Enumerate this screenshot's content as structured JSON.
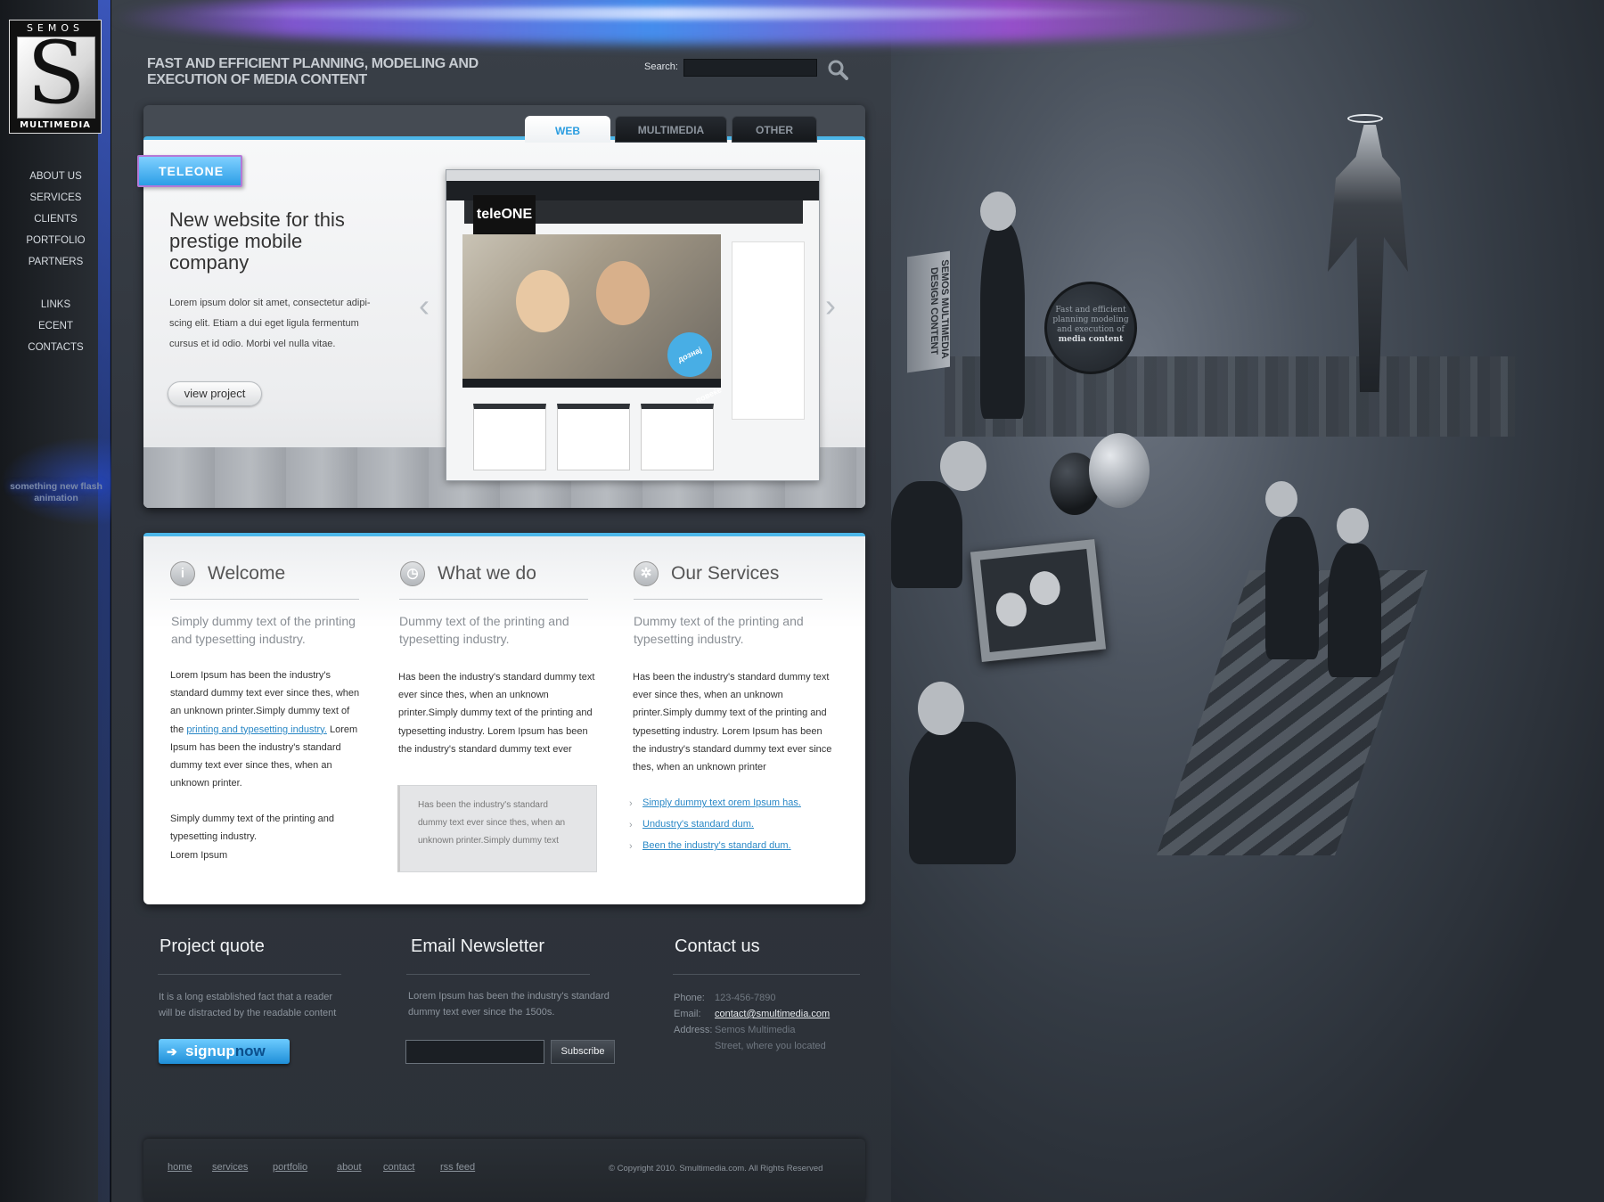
{
  "brand": {
    "logo_top": "SEMOS",
    "logo_bottom": "MULTIMEDIA",
    "logo_letter": "S",
    "tagline": "FAST AND EFFICIENT PLANNING, MODELING AND EXECUTION OF MEDIA CONTENT"
  },
  "sidebar": {
    "main_nav": [
      "ABOUT US",
      "SERVICES",
      "CLIENTS",
      "PORTFOLIO",
      "PARTNERS"
    ],
    "sub_nav": [
      "LINKS",
      "ECENT",
      "CONTACTS"
    ],
    "flash_note": "something new flash animation"
  },
  "search": {
    "label": "Search:",
    "value": "",
    "icon": "search-icon"
  },
  "slider": {
    "tabs": [
      {
        "label": "WEB",
        "active": true
      },
      {
        "label": "MULTIMEDIA",
        "active": false
      },
      {
        "label": "OTHER",
        "active": false
      }
    ],
    "badge": "TELEONE",
    "title": "New website for this prestige mobile company",
    "text": "Lorem ipsum dolor sit amet, consectetur adipi-scing elit. Etiam a dui eget ligula fermentum cursus et id odio. Morbi vel nulla vitae.",
    "button": "view project",
    "mock_logo": "teleONE",
    "mock_sticker": "дознај повеќе"
  },
  "columns": [
    {
      "icon": "info-icon",
      "icon_glyph": "i",
      "title": "Welcome",
      "lead": "Simply dummy text of the printing and typesetting industry.",
      "body_before": "Lorem Ipsum has been the industry's standard dummy text ever since thes, when an unknown printer.Simply dummy text of the ",
      "link": "printing and typesetting industry.",
      "body_after": " Lorem Ipsum has been the industry's standard dummy text ever since thes, when an unknown printer.",
      "body_2": "Simply dummy text of the printing and typesetting industry.",
      "body_3": "Lorem Ipsum"
    },
    {
      "icon": "clock-icon",
      "icon_glyph": "◷",
      "title": "What we do",
      "lead": "Dummy text of the printing and typesetting industry.",
      "body": "Has been the industry's standard dummy text ever since thes, when an unknown printer.Simply dummy text of the printing and typesetting industry. Lorem Ipsum has been the industry's standard dummy text ever",
      "quote": "Has been the industry's standard dummy text ever since thes, when an unknown printer.Simply dummy text"
    },
    {
      "icon": "gear-icon",
      "icon_glyph": "✲",
      "title": "Our Services",
      "lead": "Dummy text of the printing and typesetting industry.",
      "body": "Has been the industry's standard dummy text ever since thes, when an unknown printer.Simply dummy text of the printing and typesetting industry. Lorem Ipsum has been the industry's standard dummy text ever since thes, when an unknown printer",
      "links": [
        "Simply dummy text orem Ipsum has.",
        "Undustry's standard dum.",
        "Been the industry's standard dum."
      ]
    }
  ],
  "footer_blocks": {
    "quote": {
      "title": "Project quote",
      "text": "It is a long established fact that a reader will be distracted by the readable content",
      "button_main": "signup",
      "button_accent": "now"
    },
    "newsletter": {
      "title": "Email Newsletter",
      "text": "Lorem Ipsum has been the industry's standard dummy text ever since the 1500s.",
      "input_value": "",
      "button": "Subscribe"
    },
    "contact": {
      "title": "Contact us",
      "phone_label": "Phone:",
      "phone": "123-456-7890",
      "email_label": "Email:",
      "email": "contact@smultimedia.com",
      "address_label": "Address:",
      "address_1": "Semos Multimedia",
      "address_2": "Street, where you located"
    }
  },
  "bottom_nav": [
    "home",
    "services",
    "portfolio",
    "about",
    "contact",
    "rss feed"
  ],
  "copyright": "© Copyright 2010. Smultimedia.com. All Rights Reserved",
  "artwork": {
    "bubble_text": "Fast and efficient planning modeling and execution of",
    "bubble_bold": "media content",
    "sign_text": "SEMOS MULTIMEDIA DESIGN CONTENT"
  },
  "colors": {
    "accent_blue": "#4cb6e8",
    "link_blue": "#2a88c6",
    "badge_purple": "#b479d6"
  }
}
